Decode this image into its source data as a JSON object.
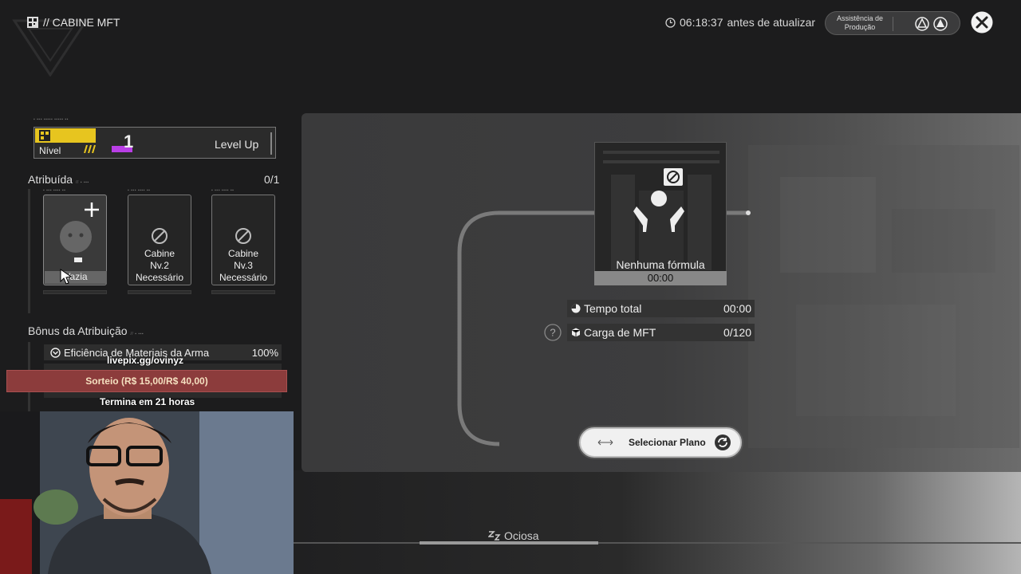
{
  "header": {
    "title": "// CABINE MFT",
    "timer_value": "06:18:37",
    "timer_suffix": "antes de atualizar",
    "assist_label": "Assistência de Produção"
  },
  "level": {
    "label": "Nível",
    "number": "1",
    "level_up": "Level Up"
  },
  "assignment": {
    "title": "Atribuída",
    "count": "0/1",
    "slots": [
      {
        "label": "Vazia"
      },
      {
        "line1": "Cabine",
        "line2": "Nv.2",
        "line3": "Necessário"
      },
      {
        "line1": "Cabine",
        "line2": "Nv.3",
        "line3": "Necessário"
      }
    ]
  },
  "bonus": {
    "title": "Bônus da Atribuição",
    "items": [
      {
        "label": "Eficiência de Materiais da Arma",
        "value": "100%"
      }
    ]
  },
  "overlay": {
    "livepix": "livepix.gg/ovinyz",
    "sorteio": "Sorteio (R$ 15,00/R$ 40,00)",
    "termina": "Termina em 21 horas"
  },
  "machine": {
    "name": "Nenhuma fórmula",
    "time": "00:00"
  },
  "stats": [
    {
      "label": "Tempo total",
      "value": "00:00"
    },
    {
      "label": "Carga de MFT",
      "value": "0/120"
    }
  ],
  "select_plan": {
    "label": "Selecionar Plano"
  },
  "status": {
    "label": "Ociosa"
  },
  "colors": {
    "accent_yellow": "#e7c51f",
    "accent_purple": "#b93fe6",
    "sorteio_red": "#8c3c3c"
  }
}
